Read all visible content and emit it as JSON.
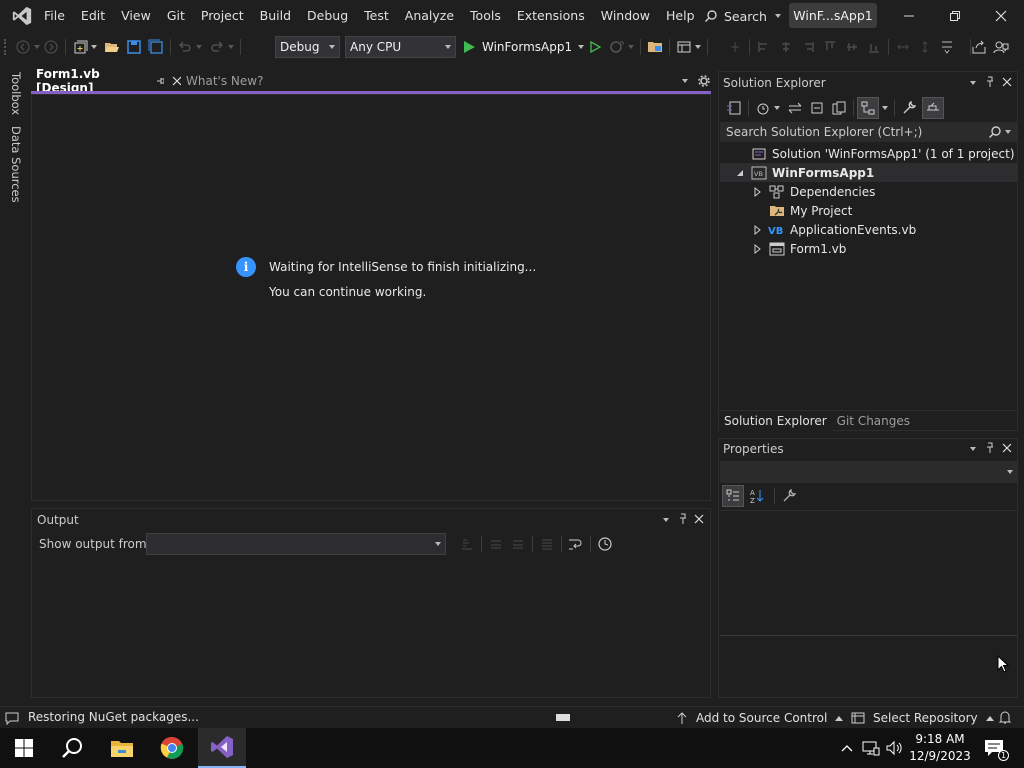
{
  "titlebar": {
    "menu": [
      "File",
      "Edit",
      "View",
      "Git",
      "Project",
      "Build",
      "Debug",
      "Test",
      "Analyze",
      "Tools",
      "Extensions",
      "Window",
      "Help"
    ],
    "search_label": "Search",
    "solution_name": "WinF...sApp1"
  },
  "toolbar": {
    "config": "Debug",
    "platform": "Any CPU",
    "run_target": "WinFormsApp1"
  },
  "side_tabs": [
    "Toolbox",
    "Data Sources"
  ],
  "editor": {
    "tabs": [
      {
        "label": "Form1.vb [Design]",
        "active": true
      },
      {
        "label": "What's New?",
        "active": false
      }
    ],
    "notice_line1": "Waiting for IntelliSense to finish initializing...",
    "notice_line2": "You can continue working."
  },
  "output": {
    "title": "Output",
    "show_from_label": "Show output from:",
    "show_from_value": ""
  },
  "solution_explorer": {
    "title": "Solution Explorer",
    "search_placeholder": "Search Solution Explorer (Ctrl+;)",
    "tree": [
      {
        "label": "Solution 'WinFormsApp1' (1 of 1 project)",
        "icon": "solution-icon",
        "level": 0,
        "expander": "none",
        "bold": false
      },
      {
        "label": "WinFormsApp1",
        "icon": "vb-project-icon",
        "level": 0,
        "expander": "expanded",
        "bold": true
      },
      {
        "label": "Dependencies",
        "icon": "dependencies-icon",
        "level": 1,
        "expander": "collapsed",
        "bold": false
      },
      {
        "label": "My Project",
        "icon": "wrench-folder-icon",
        "level": 1,
        "expander": "none",
        "bold": false
      },
      {
        "label": "ApplicationEvents.vb",
        "icon": "vb-file-icon",
        "level": 1,
        "expander": "collapsed",
        "bold": false
      },
      {
        "label": "Form1.vb",
        "icon": "form-icon",
        "level": 1,
        "expander": "collapsed",
        "bold": false
      }
    ],
    "bottom_tabs": [
      "Solution Explorer",
      "Git Changes"
    ]
  },
  "properties": {
    "title": "Properties"
  },
  "statusbar": {
    "status_text": "Restoring NuGet packages...",
    "source_control": "Add to Source Control",
    "select_repo": "Select Repository"
  },
  "taskbar": {
    "time": "9:18 AM",
    "date": "12/9/2023"
  },
  "colors": {
    "accent": "#8661c5",
    "info_blue": "#3794ff",
    "statusbar": "#1f1f1f"
  }
}
